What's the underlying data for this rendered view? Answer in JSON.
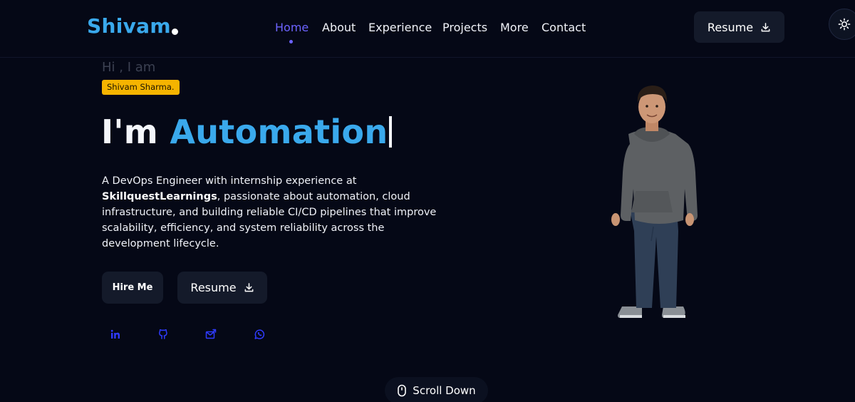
{
  "nav": {
    "logo": "Shivam",
    "links": [
      {
        "label": "Home",
        "active": true
      },
      {
        "label": "About"
      },
      {
        "label": "Experience"
      },
      {
        "label": "Projects"
      },
      {
        "label": "More"
      },
      {
        "label": "Contact"
      }
    ],
    "resume_label": "Resume",
    "theme_icon": "sun-icon"
  },
  "hero": {
    "greeting": "Hi , I am",
    "name_badge": "Shivam Sharma.",
    "headline_prefix": "I'm",
    "headline_typed": "Automation",
    "description_start": "A DevOps Engineer with internship experience at",
    "company": "SkillquestLearnings",
    "description_end": ", passionate about automation, cloud infrastructure, and building reliable CI/CD pipelines that improve scalability, efficiency, and system reliability across the development lifecycle.",
    "hire_label": "Hire Me",
    "resume_label": "Resume",
    "socials": [
      "linkedin-icon",
      "github-icon",
      "email-icon",
      "whatsapp-icon"
    ]
  },
  "scroll": {
    "label": "Scroll Down"
  },
  "colors": {
    "background": "#050816",
    "accent": "#3aa9ec",
    "nav_active": "#6c63ff",
    "badge": "#f5b400",
    "button_bg": "#141a2a",
    "social_icon": "#2f3bff"
  }
}
